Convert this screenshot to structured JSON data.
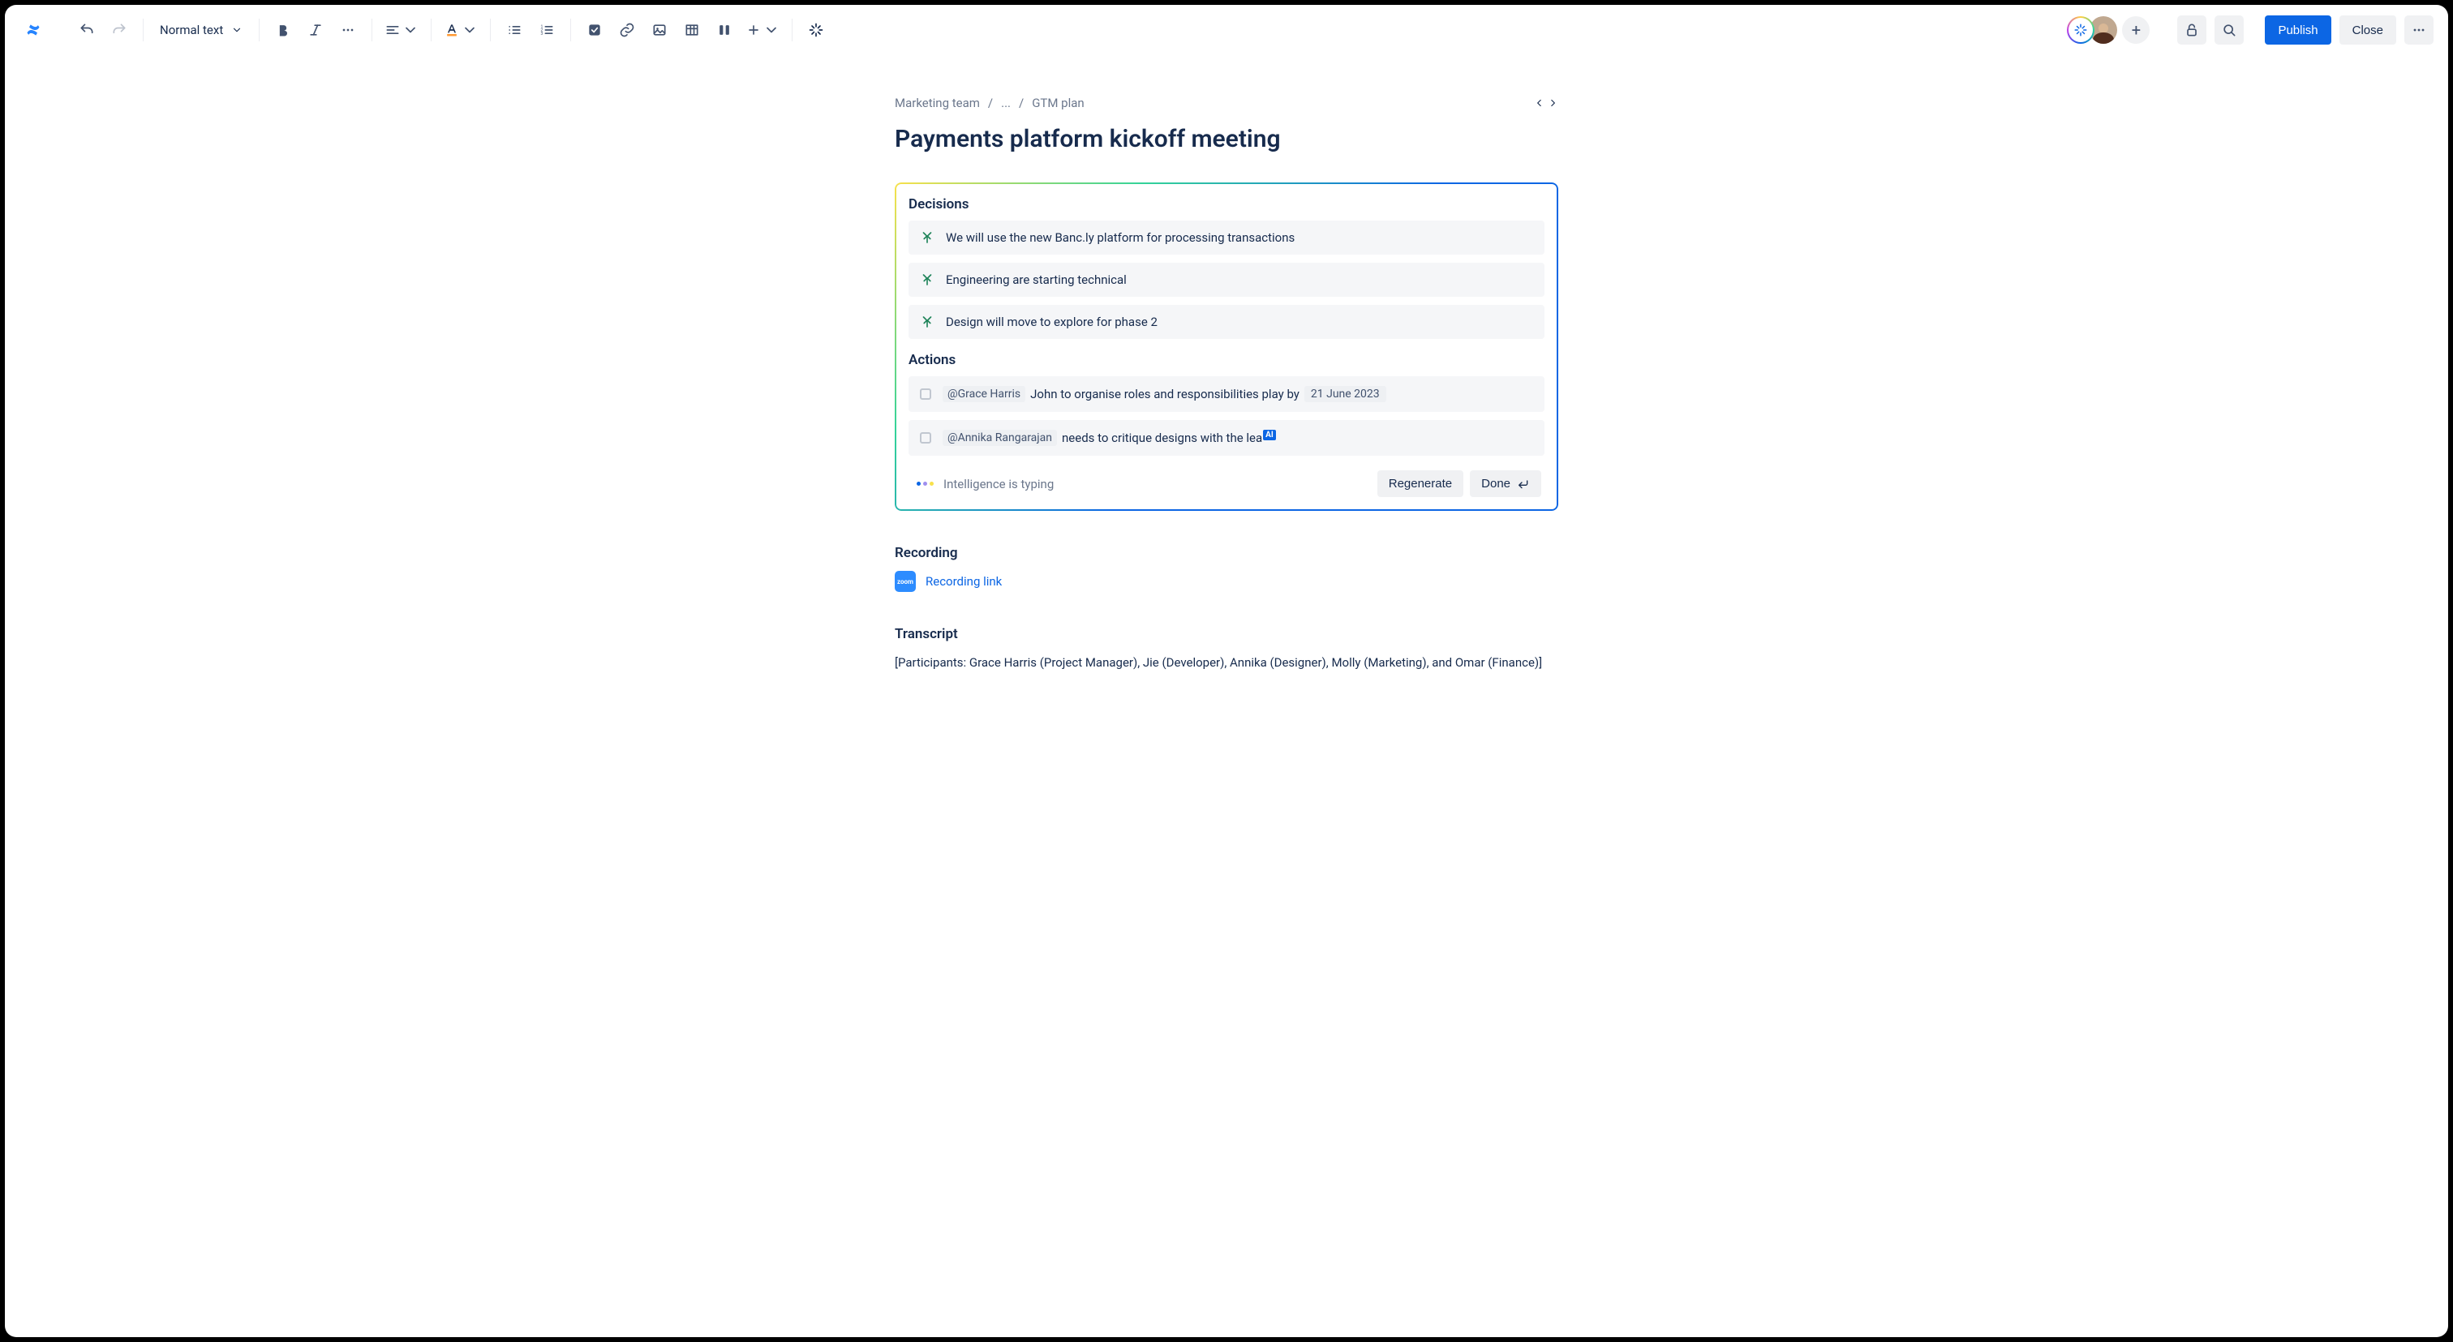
{
  "toolbar": {
    "text_style": "Normal text",
    "publish": "Publish",
    "close": "Close"
  },
  "breadcrumb": {
    "root": "Marketing team",
    "mid": "...",
    "leaf": "GTM plan"
  },
  "page_title": "Payments platform kickoff meeting",
  "ai_panel": {
    "decisions_title": "Decisions",
    "decisions": [
      "We will use the new Banc.ly platform for processing transactions",
      "Engineering are starting technical",
      "Design will move to explore for phase 2"
    ],
    "actions_title": "Actions",
    "actions": [
      {
        "mention": "@Grace Harris",
        "text": "John to organise roles and responsibilities play by",
        "date": "21 June 2023"
      },
      {
        "mention": "@Annika Rangarajan",
        "text": "needs to critique designs with the lea",
        "ai_badge": "AI"
      }
    ],
    "typing": "Intelligence is typing",
    "regenerate": "Regenerate",
    "done": "Done"
  },
  "recording": {
    "title": "Recording",
    "zoom_label": "zoom",
    "link": "Recording link"
  },
  "transcript": {
    "title": "Transcript",
    "body": "[Participants: Grace Harris (Project Manager), Jie (Developer),  Annika (Designer), Molly (Marketing), and  Omar (Finance)]"
  }
}
